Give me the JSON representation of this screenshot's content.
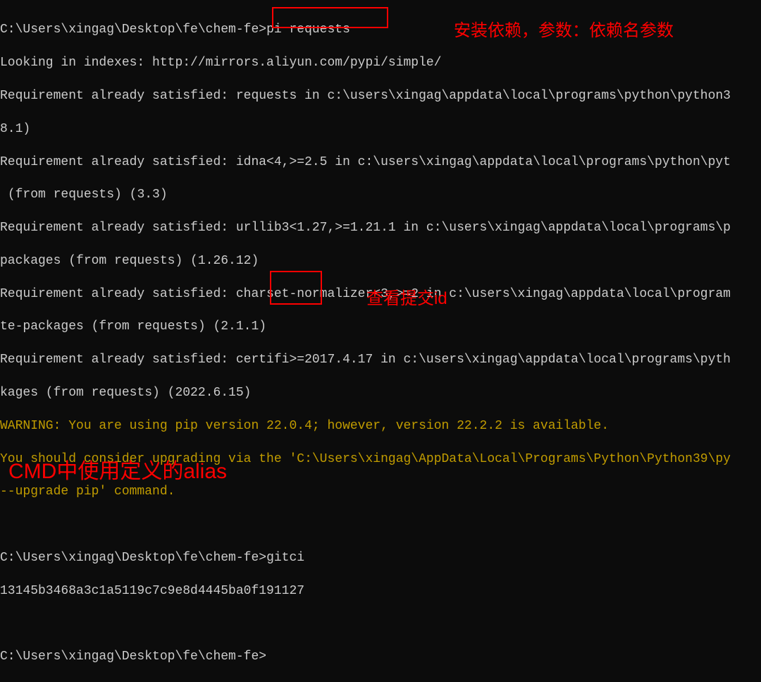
{
  "terminal": {
    "prompt1": "C:\\Users\\xingag\\Desktop\\fe\\chem-fe>",
    "command1": "pi requests",
    "out1": "Looking in indexes: http://mirrors.aliyun.com/pypi/simple/",
    "out2": "Requirement already satisfied: requests in c:\\users\\xingag\\appdata\\local\\programs\\python\\python3",
    "out3": "8.1)",
    "out4": "Requirement already satisfied: idna<4,>=2.5 in c:\\users\\xingag\\appdata\\local\\programs\\python\\pyt",
    "out5": " (from requests) (3.3)",
    "out6": "Requirement already satisfied: urllib3<1.27,>=1.21.1 in c:\\users\\xingag\\appdata\\local\\programs\\p",
    "out7": "packages (from requests) (1.26.12)",
    "out8": "Requirement already satisfied: charset-normalizer<3,>=2 in c:\\users\\xingag\\appdata\\local\\program",
    "out9": "te-packages (from requests) (2.1.1)",
    "out10": "Requirement already satisfied: certifi>=2017.4.17 in c:\\users\\xingag\\appdata\\local\\programs\\pyth",
    "out11": "kages (from requests) (2022.6.15)",
    "warn1": "WARNING: You are using pip version 22.0.4; however, version 22.2.2 is available.",
    "warn2": "You should consider upgrading via the 'C:\\Users\\xingag\\AppData\\Local\\Programs\\Python\\Python39\\py",
    "warn3": "--upgrade pip' command.",
    "blank1": " ",
    "prompt2": "C:\\Users\\xingag\\Desktop\\fe\\chem-fe>",
    "command2": "gitci",
    "out12": "13145b3468a3c1a5119c7c9e8d4445ba0f191127",
    "blank2": " ",
    "prompt3": "C:\\Users\\xingag\\Desktop\\fe\\chem-fe>"
  },
  "annotations": {
    "top_right": "安装依赖，参数：依赖名参数",
    "middle": "查看提交id",
    "bottom": "CMD中使用定义的alias"
  }
}
